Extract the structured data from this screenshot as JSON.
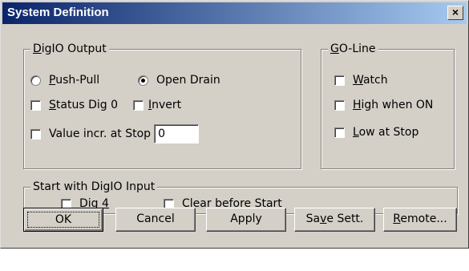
{
  "window": {
    "title": "System Definition",
    "close_label": "×"
  },
  "digio_output": {
    "legend_prefix": "",
    "legend_u": "D",
    "legend_rest": "igIO Output",
    "push_pull": {
      "u": "P",
      "rest": "ush-Pull",
      "checked": false
    },
    "open_drain": {
      "label": "Open Drain",
      "checked": true
    },
    "status_dig0": {
      "u": "S",
      "rest": "tatus Dig 0",
      "checked": false
    },
    "invert": {
      "u": "I",
      "rest": "nvert",
      "checked": false
    },
    "value_incr": {
      "label": "Value incr. at Stop",
      "checked": false,
      "value": "0"
    }
  },
  "go_line": {
    "legend_u": "G",
    "legend_rest": "O-Line",
    "watch": {
      "u": "W",
      "rest": "atch",
      "checked": false
    },
    "high_when_on": {
      "u": "H",
      "rest": "igh when ON",
      "checked": false
    },
    "low_at_stop": {
      "u": "L",
      "rest": "ow at Stop",
      "checked": false
    }
  },
  "start_input": {
    "legend": "Start with DigIO Input",
    "dig4": {
      "pre": "Dig ",
      "u": "4",
      "checked": false
    },
    "clear_before_start": {
      "u": "C",
      "rest": "lear before Start",
      "checked": false
    }
  },
  "buttons": {
    "ok": "OK",
    "cancel": "Cancel",
    "apply": "Apply",
    "save_pre": "Sa",
    "save_u": "v",
    "save_rest": "e Sett.",
    "remote_u": "R",
    "remote_rest": "emote..."
  }
}
